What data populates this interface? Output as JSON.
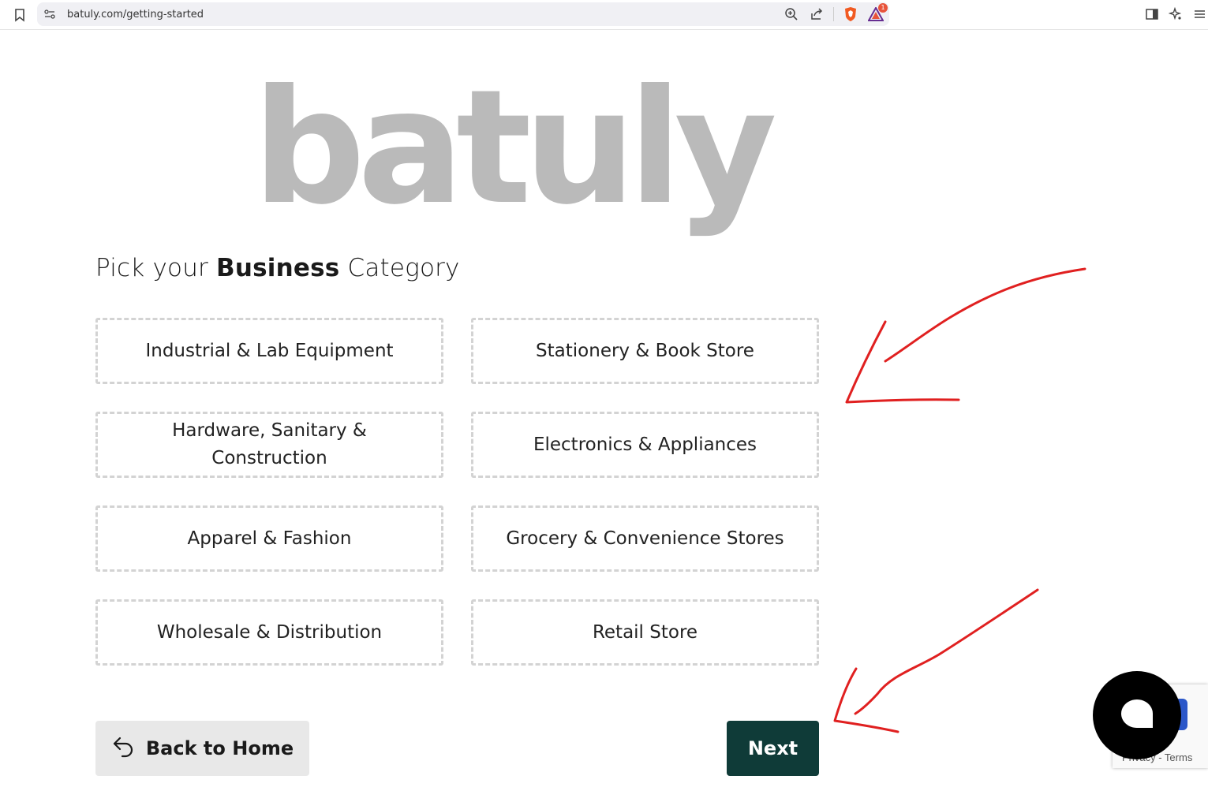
{
  "browser": {
    "url": "batuly.com/getting-started",
    "extension_badge": "1"
  },
  "page": {
    "logo_text": "batuly",
    "heading_prefix": "Pick your ",
    "heading_bold": "Business",
    "heading_suffix": " Category"
  },
  "categories": [
    {
      "label": "Industrial & Lab Equipment"
    },
    {
      "label": "Stationery & Book Store"
    },
    {
      "label": "Hardware, Sanitary & Construction"
    },
    {
      "label": "Electronics & Appliances"
    },
    {
      "label": "Apparel & Fashion"
    },
    {
      "label": "Grocery & Convenience Stores"
    },
    {
      "label": "Wholesale & Distribution"
    },
    {
      "label": "Retail Store"
    }
  ],
  "buttons": {
    "back_label": "Back to Home",
    "next_label": "Next"
  },
  "recaptcha": {
    "text": "Privacy - Terms"
  },
  "colors": {
    "logo": "#bababa",
    "next_button": "#0f3b38",
    "back_button": "#e8e8e8",
    "annotation": "#e02020"
  }
}
